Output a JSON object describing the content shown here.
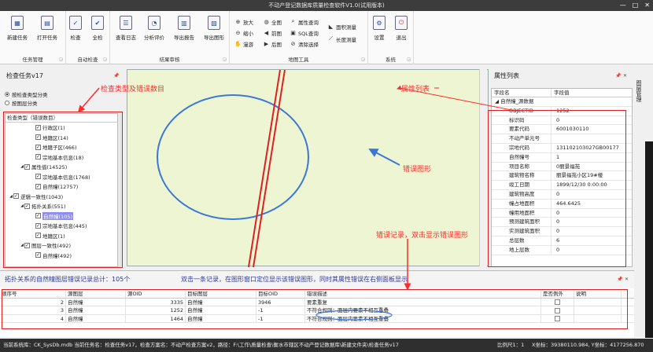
{
  "window": {
    "title": "不动产登记数据库质量检查软件V1.0(试用版本)",
    "controls": [
      "—",
      "□",
      "✕"
    ]
  },
  "ribbon": {
    "groups": [
      {
        "label": "任务管理",
        "buttons": [
          {
            "label": "新建任务",
            "icon": "new-task-icon"
          },
          {
            "label": "打开任务",
            "icon": "open-folder-icon"
          }
        ]
      },
      {
        "label": "自动检查",
        "buttons": [
          {
            "label": "检查",
            "icon": "check-icon"
          },
          {
            "label": "全检",
            "icon": "check-all-icon"
          }
        ]
      },
      {
        "label": "结果审核",
        "buttons": [
          {
            "label": "查看日志",
            "icon": "log-icon"
          },
          {
            "label": "分析评价",
            "icon": "analysis-icon"
          },
          {
            "label": "导出报告",
            "icon": "export-report-icon"
          },
          {
            "label": "导出图形",
            "icon": "export-graphic-icon"
          }
        ]
      },
      {
        "label": "地图工具",
        "small": [
          "放大",
          "全图",
          "属性查询",
          "面积测量",
          "缩小",
          "前图",
          "SQL查询",
          "长度测量",
          "漫游",
          "后图",
          "清除选择"
        ]
      },
      {
        "label": "系统",
        "buttons": [
          {
            "label": "设置",
            "icon": "settings-icon"
          },
          {
            "label": "退出",
            "icon": "exit-icon"
          }
        ]
      }
    ]
  },
  "left_panel": {
    "title": "检查任务v17",
    "radios": [
      {
        "label": "按检查类型分类",
        "checked": true
      },
      {
        "label": "按图层分类",
        "checked": false
      }
    ],
    "tree_header": "检查类型（错误数目）",
    "tree": [
      {
        "label": "行政区(1)",
        "level": 2,
        "checked": true
      },
      {
        "label": "地籍区(14)",
        "level": 2,
        "checked": true
      },
      {
        "label": "地籍子区(466)",
        "level": 2,
        "checked": true
      },
      {
        "label": "宗地基本信息(18)",
        "level": 2,
        "checked": true
      },
      {
        "label": "属性值(14525)",
        "level": 1,
        "checked": true,
        "expanded": true
      },
      {
        "label": "宗地基本信息(1768)",
        "level": 2,
        "checked": true
      },
      {
        "label": "自然幢(12757)",
        "level": 2,
        "checked": true
      },
      {
        "label": "逻辑一致性(1043)",
        "level": 0,
        "checked": true,
        "expanded": true
      },
      {
        "label": "拓扑关系(551)",
        "level": 1,
        "checked": true,
        "expanded": true
      },
      {
        "label": "自然幢(105)",
        "level": 2,
        "checked": true,
        "selected": true
      },
      {
        "label": "宗地基本信息(445)",
        "level": 2,
        "checked": true
      },
      {
        "label": "地籍区(1)",
        "level": 2,
        "checked": true
      },
      {
        "label": "图层一致性(492)",
        "level": 1,
        "checked": true,
        "expanded": true
      },
      {
        "label": "自然幢(492)",
        "level": 2,
        "checked": true
      }
    ]
  },
  "right_panel": {
    "title": "属性列表",
    "headers": [
      "字段名",
      "字段值"
    ],
    "group": "自然幢_源数据",
    "rows": [
      [
        "OBJECTID",
        "1252"
      ],
      [
        "标识码",
        "0"
      ],
      [
        "要素代码",
        "6001030110"
      ],
      [
        "不动产单元号",
        ""
      ],
      [
        "宗地代码",
        "131102103027GB00177"
      ],
      [
        "自然幢号",
        "1"
      ],
      [
        "项目名称",
        "0丽景福苑"
      ],
      [
        "建筑物名称",
        "丽景福苑小区19#楼"
      ],
      [
        "竣工日期",
        "1899/12/30 0:00:00"
      ],
      [
        "建筑物高度",
        "0"
      ],
      [
        "幢占地面积",
        "464.6425"
      ],
      [
        "幢用地面积",
        "0"
      ],
      [
        "预测建筑面积",
        "0"
      ],
      [
        "实测建筑面积",
        "0"
      ],
      [
        "总层数",
        "6"
      ],
      [
        "地上层数",
        "0"
      ]
    ],
    "side_tab": "图层管理"
  },
  "bottom": {
    "summary": "拓扑关系的自然幢图层错误记录总计：105个",
    "hint": "双击一条记录，在图形窗口定位显示该错误图形，同时其属性错误在右侧面板显示",
    "columns": [
      "顺序号",
      "源图层",
      "源OID",
      "目标图层",
      "目标OID",
      "错误描述",
      "是否例外",
      "说明"
    ],
    "rows": [
      {
        "seq": "2",
        "src": "自然幢",
        "soid": "3335",
        "tgt": "自然幢",
        "toid": "3946",
        "desc": "要素重复"
      },
      {
        "seq": "3",
        "src": "自然幢",
        "soid": "1252",
        "tgt": "自然幢",
        "toid": "-1",
        "desc": "不符合规则：面层内要素不相互重叠"
      },
      {
        "seq": "4",
        "src": "自然幢",
        "soid": "1464",
        "tgt": "自然幢",
        "toid": "-1",
        "desc": "不符合规则：面层内要素不相互重叠"
      }
    ]
  },
  "annotations": {
    "check_types": "检查类型及错误数目",
    "attr_list": "属性列表",
    "error_graphic": "错误图形",
    "error_records": "错误记录，双击显示错误图形"
  },
  "statusbar": {
    "text": "当前系统库：CK_SysDb.mdb 当前任务名：检查任务v17，检查方案名：不动产检查方案v2，路径：F:\\工作\\质量检查\\衡水市辖区不动产登记数据库\\新建文件夹\\检查任务v17",
    "scale": "比例尺1：1",
    "coords": "X坐标：39380110.984, Y坐标：4177256.870"
  },
  "colors": {
    "annotation": "#ff2b2b",
    "map_bg": "#eef5d2",
    "ellipse": "#3a78d8",
    "selected": "#8e8ef0"
  }
}
